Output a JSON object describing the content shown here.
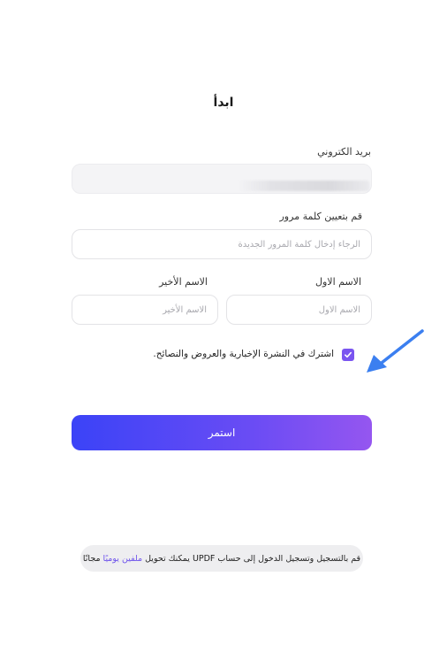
{
  "page": {
    "title": "ابدأ"
  },
  "form": {
    "email": {
      "label": "بريد الكتروني",
      "value": ""
    },
    "password": {
      "label": "قم بتعيين كلمة مرور",
      "placeholder": "الرجاء إدخال كلمة المرور الجديدة"
    },
    "first_name": {
      "label": "الاسم الاول",
      "placeholder": "الاسم الاول"
    },
    "last_name": {
      "label": "الاسم الأخير",
      "placeholder": "الاسم الأخير"
    },
    "newsletter": {
      "label": "اشترك في النشرة الإخبارية والعروض والنصائح.",
      "checked": true
    },
    "continue_label": "استمر"
  },
  "footer": {
    "text_before": "قم بالتسجيل وتسجيل الدخول إلى حساب UPDF يمكنك تحويل",
    "link_text": "ملفين يوميًا",
    "text_after": "مجانًا"
  },
  "colors": {
    "accent": "#7a55f0",
    "button_gradient_start": "#3b43f7",
    "button_gradient_end": "#9556f0",
    "arrow": "#3b7ff0"
  }
}
